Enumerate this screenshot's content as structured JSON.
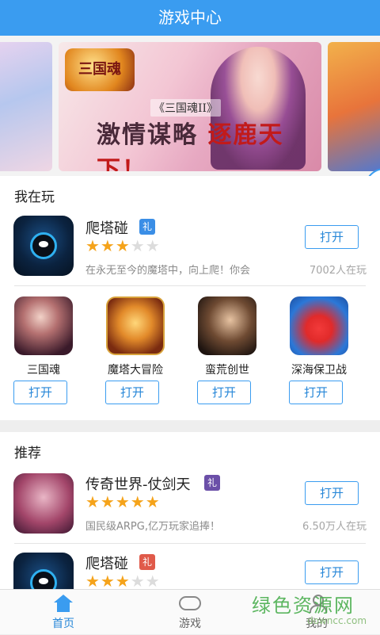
{
  "header": {
    "title": "游戏中心"
  },
  "banner": {
    "logo_text": "三国魂",
    "subtitle": "《三国魂II》",
    "headline_left": "激情谋略",
    "headline_right": "逐鹿天下！"
  },
  "playing": {
    "title": "我在玩",
    "featured": {
      "name": "爬塔碰",
      "gift_label": "礼",
      "gift_color": "#3a8ee6",
      "stars_on": "★★★",
      "stars_off": "★★",
      "rating": 3,
      "desc": "在永无至今的魔塔中，向上爬！你会",
      "count": "7002人在玩",
      "button": "打开"
    },
    "grid": [
      {
        "name": "三国魂",
        "button": "打开"
      },
      {
        "name": "魔塔大冒险",
        "button": "打开"
      },
      {
        "name": "蛮荒创世",
        "button": "打开"
      },
      {
        "name": "深海保卫战",
        "button": "打开"
      }
    ]
  },
  "recommend": {
    "title": "推荐",
    "items": [
      {
        "name": "传奇世界-仗剑天",
        "gift_label": "礼",
        "gift_color": "#6b4fa8",
        "stars_on": "★★★★★",
        "stars_off": "",
        "rating": 5,
        "desc": "国民级ARPG,亿万玩家追捧！",
        "count": "6.50万人在玩",
        "button": "打开"
      },
      {
        "name": "爬塔碰",
        "gift_label": "礼",
        "gift_color": "#e05a4a",
        "stars_on": "★★★",
        "stars_off": "★★",
        "rating": 3,
        "button": "打开"
      }
    ]
  },
  "tabbar": {
    "tabs": [
      {
        "label": "首页",
        "icon": "home-icon",
        "active": true
      },
      {
        "label": "游戏",
        "icon": "gamepad-icon",
        "active": false
      },
      {
        "label": "我的",
        "icon": "person-icon",
        "active": false
      }
    ]
  },
  "watermark": {
    "main": "绿色资源网",
    "sub": "downcc.com"
  },
  "colors": {
    "accent": "#3a9cf0",
    "star": "#f5a31a"
  }
}
